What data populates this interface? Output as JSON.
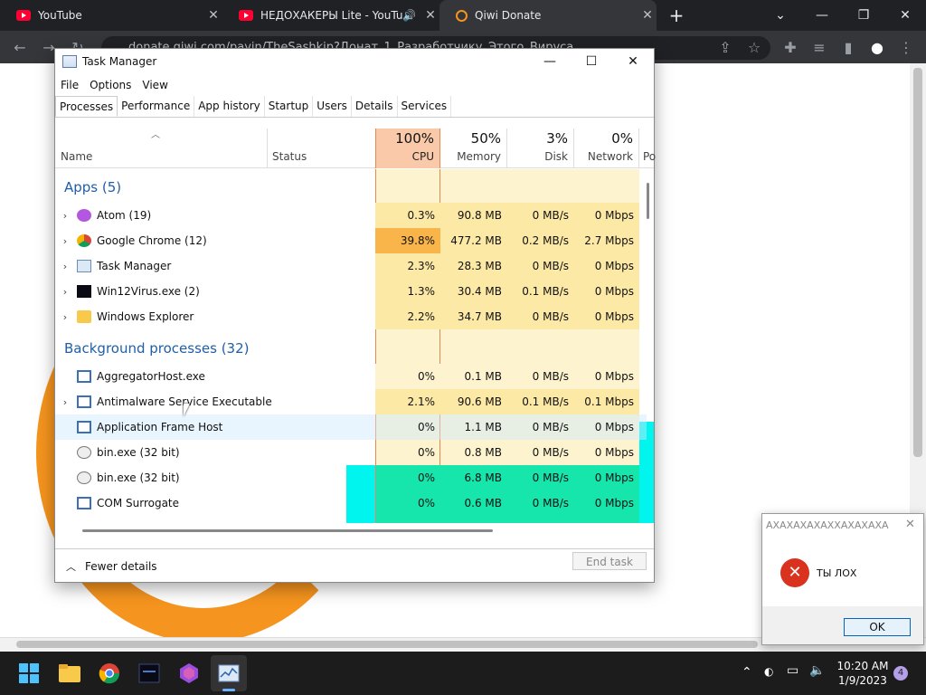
{
  "browser": {
    "tabs": [
      {
        "label": "YouTube",
        "icon": "youtube-icon"
      },
      {
        "label": "НЕДОХАКЕРЫ Lite - YouTube",
        "icon": "youtube-icon"
      },
      {
        "label": "Qiwi Donate",
        "icon": "qiwi-icon"
      }
    ],
    "address": "donate.qiwi.com/payin/TheSashkip?Донат_1_Разработчику_Этого_Вируса"
  },
  "task_manager": {
    "title": "Task Manager",
    "menu": [
      "File",
      "Options",
      "View"
    ],
    "tabs": [
      "Processes",
      "Performance",
      "App history",
      "Startup",
      "Users",
      "Details",
      "Services"
    ],
    "columns": {
      "name": "Name",
      "status": "Status",
      "cpu": {
        "pct": "100%",
        "label": "CPU"
      },
      "memory": {
        "pct": "50%",
        "label": "Memory"
      },
      "disk": {
        "pct": "3%",
        "label": "Disk"
      },
      "network": {
        "pct": "0%",
        "label": "Network"
      },
      "power": "Po"
    },
    "groups": {
      "apps": "Apps (5)",
      "background": "Background processes (32)"
    },
    "apps": [
      {
        "name": "Atom (19)",
        "cpu": "0.3%",
        "memory": "90.8 MB",
        "disk": "0 MB/s",
        "network": "0 Mbps"
      },
      {
        "name": "Google Chrome (12)",
        "cpu": "39.8%",
        "memory": "477.2 MB",
        "disk": "0.2 MB/s",
        "network": "2.7 Mbps"
      },
      {
        "name": "Task Manager",
        "cpu": "2.3%",
        "memory": "28.3 MB",
        "disk": "0 MB/s",
        "network": "0 Mbps"
      },
      {
        "name": "Win12Virus.exe (2)",
        "cpu": "1.3%",
        "memory": "30.4 MB",
        "disk": "0.1 MB/s",
        "network": "0 Mbps"
      },
      {
        "name": "Windows Explorer",
        "cpu": "2.2%",
        "memory": "34.7 MB",
        "disk": "0 MB/s",
        "network": "0 Mbps"
      }
    ],
    "background": [
      {
        "name": "AggregatorHost.exe",
        "cpu": "0%",
        "memory": "0.1 MB",
        "disk": "0 MB/s",
        "network": "0 Mbps"
      },
      {
        "name": "Antimalware Service Executable",
        "cpu": "2.1%",
        "memory": "90.6 MB",
        "disk": "0.1 MB/s",
        "network": "0.1 Mbps"
      },
      {
        "name": "Application Frame Host",
        "cpu": "0%",
        "memory": "1.1 MB",
        "disk": "0 MB/s",
        "network": "0 Mbps"
      },
      {
        "name": "bin.exe (32 bit)",
        "cpu": "0%",
        "memory": "0.8 MB",
        "disk": "0 MB/s",
        "network": "0 Mbps"
      },
      {
        "name": "bin.exe (32 bit)",
        "cpu": "0%",
        "memory": "6.8 MB",
        "disk": "0 MB/s",
        "network": "0 Mbps"
      },
      {
        "name": "COM Surrogate",
        "cpu": "0%",
        "memory": "0.6 MB",
        "disk": "0 MB/s",
        "network": "0 Mbps"
      }
    ],
    "fewer_details": "Fewer details",
    "end_task": "End task"
  },
  "dialog": {
    "title": "АХАХАХАХАХХАХАХАХА",
    "message": "ТЫ ЛОХ",
    "ok": "OK"
  },
  "taskbar": {
    "time": "10:20 AM",
    "date": "1/9/2023",
    "badge": "4"
  },
  "colors": {
    "cpu_hot": "#f9b44a",
    "cpu_warm": "#fde9a6",
    "cpu_light": "#fdf4cf",
    "glitch_cyan": "#00f5ee",
    "glitch_green": "#16e5ac",
    "accent": "#1f5fa8"
  }
}
